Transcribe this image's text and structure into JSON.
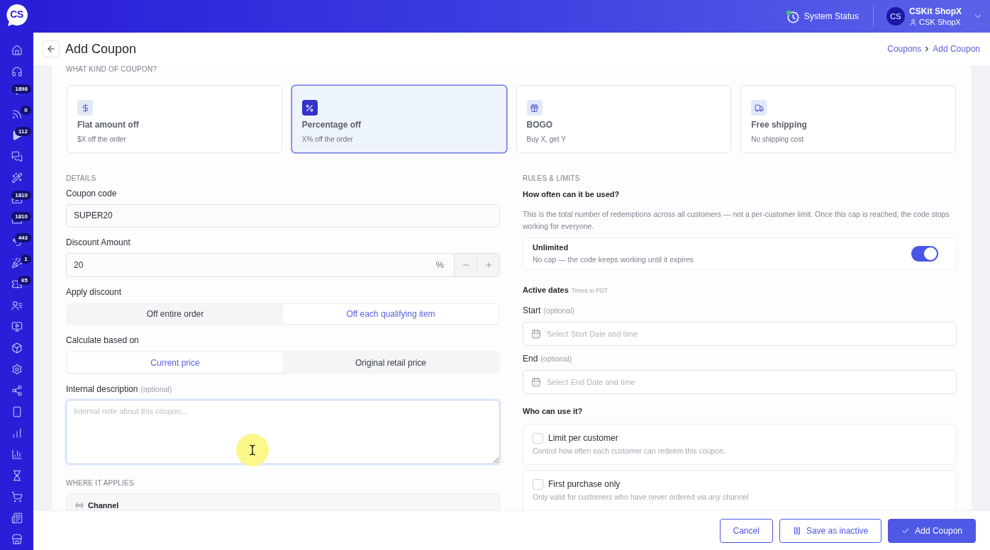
{
  "logo": "CS",
  "sidebar": {
    "items": [
      {
        "selected": false
      },
      {
        "selected": false
      },
      {
        "badge": "1898",
        "selected": false
      },
      {
        "badge": "0",
        "selected": false
      },
      {
        "badge": "112",
        "selected": false
      },
      {
        "selected": false
      },
      {
        "selected": false
      },
      {
        "badge": "1810",
        "selected": false
      },
      {
        "badge": "1810",
        "selected": false
      },
      {
        "badge": "443",
        "selected": false
      },
      {
        "badge": "1",
        "selected": false
      },
      {
        "badge": "65",
        "selected": false
      },
      {
        "selected": false
      },
      {
        "selected": false
      },
      {
        "selected": false
      },
      {
        "selected": false
      },
      {
        "selected": false
      },
      {
        "selected": false
      },
      {
        "selected": false
      },
      {
        "selected": false
      },
      {
        "selected": false
      },
      {
        "selected": false
      },
      {
        "selected": false
      },
      {
        "selected": false
      }
    ]
  },
  "top_bar": {
    "system_status": "System Status",
    "account": {
      "avatar": "CS",
      "name": "CSKit ShopX",
      "store": "CSK ShopX"
    }
  },
  "page": {
    "title": "Add Coupon",
    "breadcrumb": [
      {
        "label": "Coupons"
      },
      {
        "label": "Add Coupon"
      }
    ]
  },
  "coupon_types": {
    "heading": "WHAT KIND OF COUPON?",
    "options": [
      {
        "title": "Flat amount off",
        "subtitle": "$X off the order",
        "selected": false
      },
      {
        "title": "Percentage off",
        "subtitle": "X% off the order",
        "selected": true
      },
      {
        "title": "BOGO",
        "subtitle": "Buy X, get Y",
        "selected": false
      },
      {
        "title": "Free shipping",
        "subtitle": "No shipping cost",
        "selected": false
      }
    ]
  },
  "details": {
    "heading": "DETAILS",
    "coupon_code": {
      "label": "Coupon code",
      "value": "SUPER20"
    },
    "discount_amount": {
      "label": "Discount Amount",
      "value": "20",
      "unit": "%"
    },
    "apply_discount": {
      "label": "Apply discount",
      "options": [
        {
          "label": "Off entire order",
          "selected": false
        },
        {
          "label": "Off each qualifying item",
          "selected": true
        }
      ]
    },
    "calculate_based_on": {
      "label": "Calculate based on",
      "options": [
        {
          "label": "Current price",
          "selected": true
        },
        {
          "label": "Original retail price",
          "selected": false
        }
      ]
    },
    "internal_description": {
      "label": "Internal description",
      "hint": "(optional)",
      "placeholder": "Internal note about this coupon..."
    }
  },
  "where_it_applies": {
    "heading": "WHERE IT APPLIES",
    "channel": "Channel"
  },
  "rules": {
    "heading": "RULES & LIMITS",
    "usage": {
      "title": "How often can it be used?",
      "description": "This is the total number of redemptions across all customers — not a per-customer limit. Once this cap is reached, the code stops working for everyone.",
      "unlimited": {
        "title": "Unlimited",
        "description": "No cap — the code keeps working until it expires",
        "on": true
      }
    },
    "active_dates": {
      "title": "Active dates",
      "note": "Times in PDT",
      "start": {
        "label": "Start",
        "hint": "(optional)",
        "placeholder": "Select Start Date and time"
      },
      "end": {
        "label": "End",
        "hint": "(optional)",
        "placeholder": "Select End Date and time"
      }
    },
    "who_can_use": {
      "title": "Who can use it?",
      "options": [
        {
          "title": "Limit per customer",
          "description": "Control how often each customer can redeem this coupon.",
          "checked": false
        },
        {
          "title": "First purchase only",
          "description": "Only valid for customers who have never ordered via any channel",
          "checked": false
        }
      ]
    }
  },
  "footer": {
    "buttons": [
      {
        "label": "Cancel",
        "kind": "plain"
      },
      {
        "label": "Save as inactive",
        "kind": "secondary"
      },
      {
        "label": "Add Coupon",
        "kind": "primary"
      }
    ]
  }
}
